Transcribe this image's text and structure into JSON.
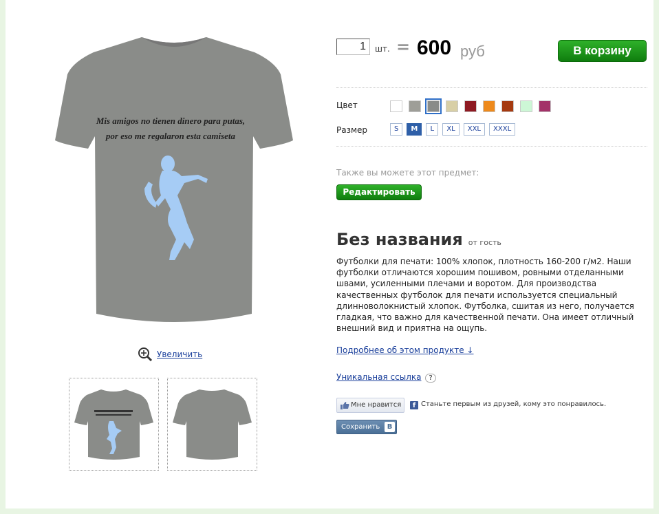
{
  "product": {
    "quantity": "1",
    "quantity_unit": "шт.",
    "equals": "=",
    "price": "600",
    "currency": "руб",
    "add_to_cart": "В корзину",
    "color_label": "Цвет",
    "size_label": "Размер",
    "colors": [
      "#ffffff",
      "#9e9e98",
      "#8a8c89",
      "#d8cfa6",
      "#8e1a22",
      "#ee8a1c",
      "#a53a10",
      "#cdf7d6",
      "#a33268"
    ],
    "selected_color": "#8a8c89",
    "sizes": [
      "S",
      "M",
      "L",
      "XL",
      "XXL",
      "XXXL"
    ],
    "selected_size": "M",
    "also_text": "Также вы можете этот предмет:",
    "edit_button": "Редактировать",
    "title": "Без названия",
    "author": "от гость",
    "description": "Футболки для печати: 100% хлопок, плотность 160-200 г/м2. Наши футболки отличаются хорошим пошивом, ровными отделанными швами, усиленными плечами и воротом. Для производства качественных футболок для печати используется специальный длинноволокнистый хлопок. Футболка, сшитая из него, получается гладкая, что важно для качественной печати. Она имеет отличный внешний вид и приятна на ощупь.",
    "more_link": "Подробнее об этом продукте ↓",
    "unique_link": "Уникальная ссылка",
    "unique_help": "?",
    "shirt_color": "#8a8c89",
    "print_color": "#a6ccf5"
  },
  "gallery": {
    "print_line1": "Mis amigos no tienen dinero para putas,",
    "print_line2": "por eso me regalaron esta camiseta",
    "zoom_label": "Увеличить"
  },
  "social": {
    "like_button": "Мне нравится",
    "fb_text": "Станьте первым из друзей, кому это понравилось.",
    "vk_button": "Сохранить",
    "vk_logo": "В"
  }
}
